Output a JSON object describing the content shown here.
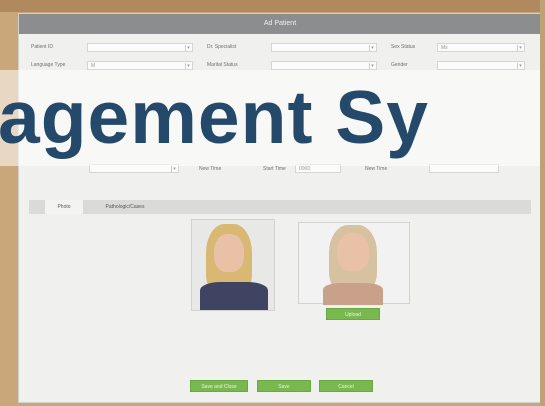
{
  "window": {
    "title": "Ad Patient"
  },
  "banner": {
    "text": "agement Sy"
  },
  "form": {
    "row1": [
      {
        "label": "Patient ID",
        "value": ""
      },
      {
        "label": "Dr. Specialist",
        "value": ""
      },
      {
        "label": "Sex Status",
        "value": "Ms"
      }
    ],
    "row2": [
      {
        "label": "Language Type",
        "value": "M"
      },
      {
        "label": "Marital Status",
        "value": ""
      },
      {
        "label": "Gender",
        "value": ""
      }
    ],
    "row5": [
      {
        "label": "",
        "value": ""
      },
      {
        "label": "New Time",
        "value": ""
      },
      {
        "label": "Start Time",
        "value": "0000"
      },
      {
        "label": "New Time",
        "value": ""
      },
      {
        "label": "",
        "value": ""
      }
    ]
  },
  "tabs": [
    "Photo",
    "Pathologic/Cases"
  ],
  "photos": [
    {
      "hair": "#d9b873",
      "shirt": "#3f4462"
    },
    {
      "hair": "#d6c2a0",
      "shirt": "#c9a08a"
    }
  ],
  "buttons": {
    "photo2_action": "Upload",
    "footer": [
      "Save and Close",
      "Save",
      "Cancel"
    ]
  },
  "colors": {
    "titlebar": "#8b8d8f",
    "button": "#79b84f",
    "banner_text": "#24496b"
  }
}
